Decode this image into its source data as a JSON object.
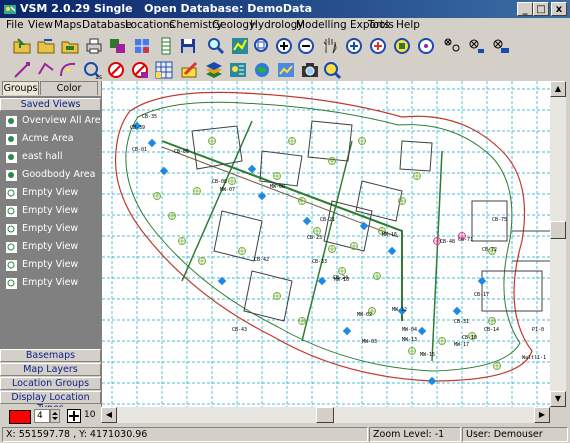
{
  "window": {
    "title": "VSM 2.0.29 Single   Open Database: DemoData",
    "min_label": "_",
    "max_label": "□",
    "close_label": "x"
  },
  "menu": [
    "File",
    "View",
    "Maps",
    "Database",
    "Locations",
    "Chemistry",
    "Geology",
    "Hydrology",
    "Modelling Exports",
    "Tools",
    "Help"
  ],
  "sidebar": {
    "tabs": [
      "Groups",
      "Color Legend"
    ],
    "saved_views_header": "Saved Views",
    "views": [
      "Overview All Areas",
      "Acme Area",
      "east hall",
      "Goodbody Area",
      "Empty View",
      "Empty View",
      "Empty View",
      "Empty View",
      "Empty View",
      "Empty View"
    ],
    "sections": [
      "Basemaps",
      "Map Layers",
      "Location Groups",
      "Display Location Types"
    ],
    "symbol_size": "4",
    "label_size": "10",
    "symbol_color": "#ff0000"
  },
  "map": {
    "labels": [
      "CB-35",
      "CB-39",
      "CB-01",
      "CB-06",
      "CB-08",
      "MW-07",
      "CB-42",
      "CB-43",
      "MW-08",
      "CB-23",
      "CB-21",
      "CB-24",
      "CB-48",
      "MW-16",
      "MW-02",
      "MW-03",
      "MW-04",
      "MW-10",
      "MW-12",
      "MW-13",
      "MW-15",
      "MW-17",
      "CB-17",
      "CB-71",
      "CB-72",
      "CB-75",
      "CB-10",
      "CB-14",
      "CB-31",
      "CB-33",
      "P1-0",
      "Waltl1-1"
    ],
    "colors": {
      "grid": "#1aa7c7",
      "boundary": "#c0392b",
      "road": "#2e7d32",
      "building": "#404040",
      "well_blue": "#1e88e5",
      "well_green": "#7cb342",
      "well_magenta": "#e040a0"
    }
  },
  "status": {
    "coords": "X: 551597.78 , Y: 4171030.96",
    "zoom": "Zoom Level: -1",
    "user": "User: Demouser"
  }
}
